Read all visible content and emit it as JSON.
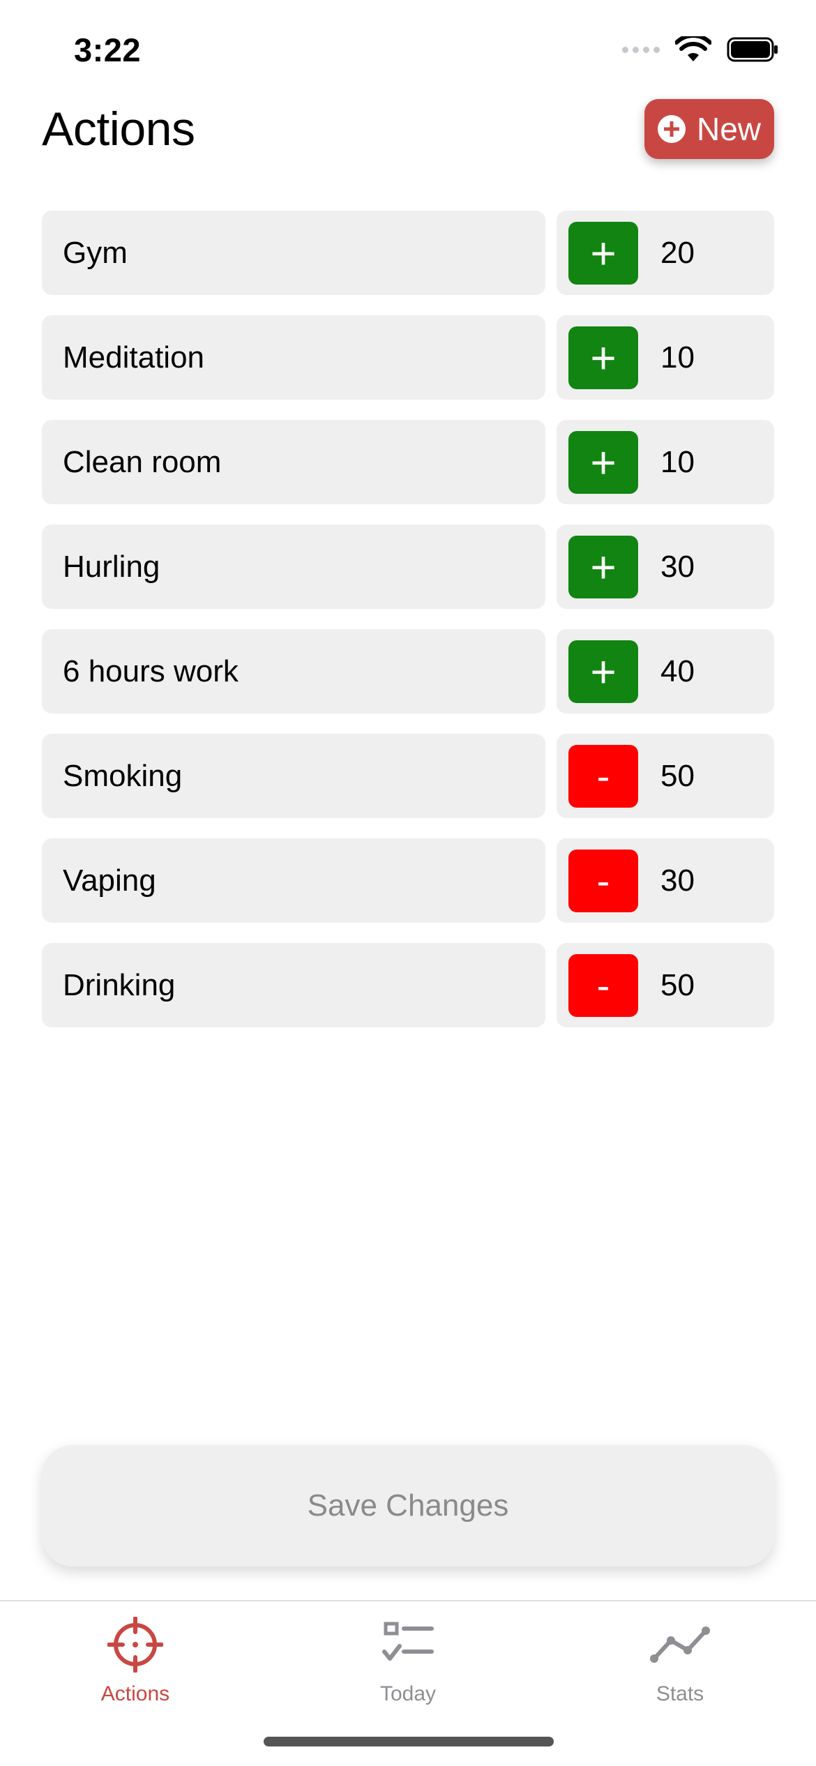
{
  "status_bar": {
    "time": "3:22"
  },
  "header": {
    "title": "Actions",
    "new_button_label": "New"
  },
  "colors": {
    "accent": "#c94743",
    "positive": "#118411",
    "negative": "#ff0000",
    "row_background": "#efefef"
  },
  "actions": [
    {
      "name": "Gym",
      "sign": "+",
      "points": "20"
    },
    {
      "name": "Meditation",
      "sign": "+",
      "points": "10"
    },
    {
      "name": "Clean room",
      "sign": "+",
      "points": "10"
    },
    {
      "name": "Hurling",
      "sign": "+",
      "points": "30"
    },
    {
      "name": "6 hours work",
      "sign": "+",
      "points": "40"
    },
    {
      "name": "Smoking",
      "sign": "-",
      "points": "50"
    },
    {
      "name": "Vaping",
      "sign": "-",
      "points": "30"
    },
    {
      "name": "Drinking",
      "sign": "-",
      "points": "50"
    }
  ],
  "save_button_label": "Save Changes",
  "tabs": [
    {
      "label": "Actions",
      "icon": "crosshair-icon",
      "active": true
    },
    {
      "label": "Today",
      "icon": "checklist-icon",
      "active": false
    },
    {
      "label": "Stats",
      "icon": "line-chart-icon",
      "active": false
    }
  ]
}
